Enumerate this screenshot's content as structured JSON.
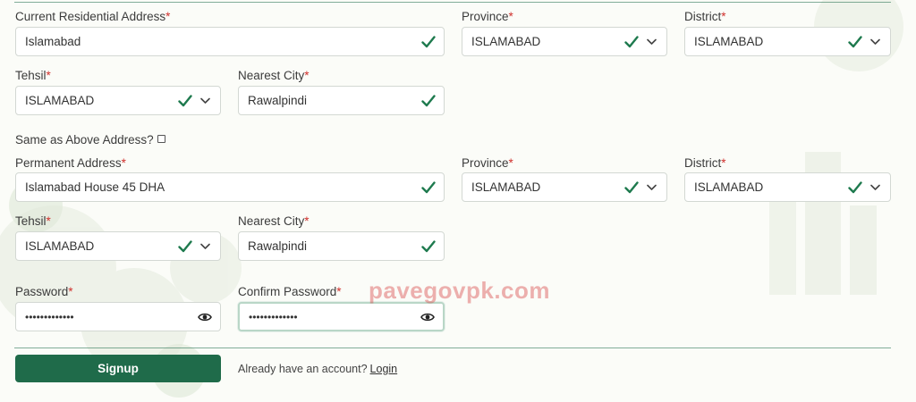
{
  "required_mark": "*",
  "current": {
    "address_label": "Current Residential Address",
    "address_value": "Islamabad",
    "province_label": "Province",
    "province_value": "ISLAMABAD",
    "district_label": "District",
    "district_value": "ISLAMABAD",
    "tehsil_label": "Tehsil",
    "tehsil_value": "ISLAMABAD",
    "city_label": "Nearest City",
    "city_value": "Rawalpindi"
  },
  "same_as_above_label": "Same as Above Address?",
  "same_as_above_checked": false,
  "permanent": {
    "address_label": "Permanent Address",
    "address_value": "Islamabad House 45 DHA",
    "province_label": "Province",
    "province_value": "ISLAMABAD",
    "district_label": "District",
    "district_value": "ISLAMABAD",
    "tehsil_label": "Tehsil",
    "tehsil_value": "ISLAMABAD",
    "city_label": "Nearest City",
    "city_value": "Rawalpindi"
  },
  "password": {
    "label": "Password",
    "masked_value": "•••••••••••••"
  },
  "confirm_password": {
    "label": "Confirm Password",
    "masked_value": "•••••••••••••"
  },
  "signup_label": "Signup",
  "login_prompt": "Already have an account?",
  "login_link": "Login",
  "watermark": "pavegovpk.com",
  "icons": {
    "valid": "check-icon",
    "dropdown": "chevron-down-icon",
    "reveal": "eye-icon"
  },
  "colors": {
    "accent": "#1f6b4a",
    "check": "#1e7a4e",
    "required": "#d0312d",
    "background": "#fbfcf8"
  }
}
